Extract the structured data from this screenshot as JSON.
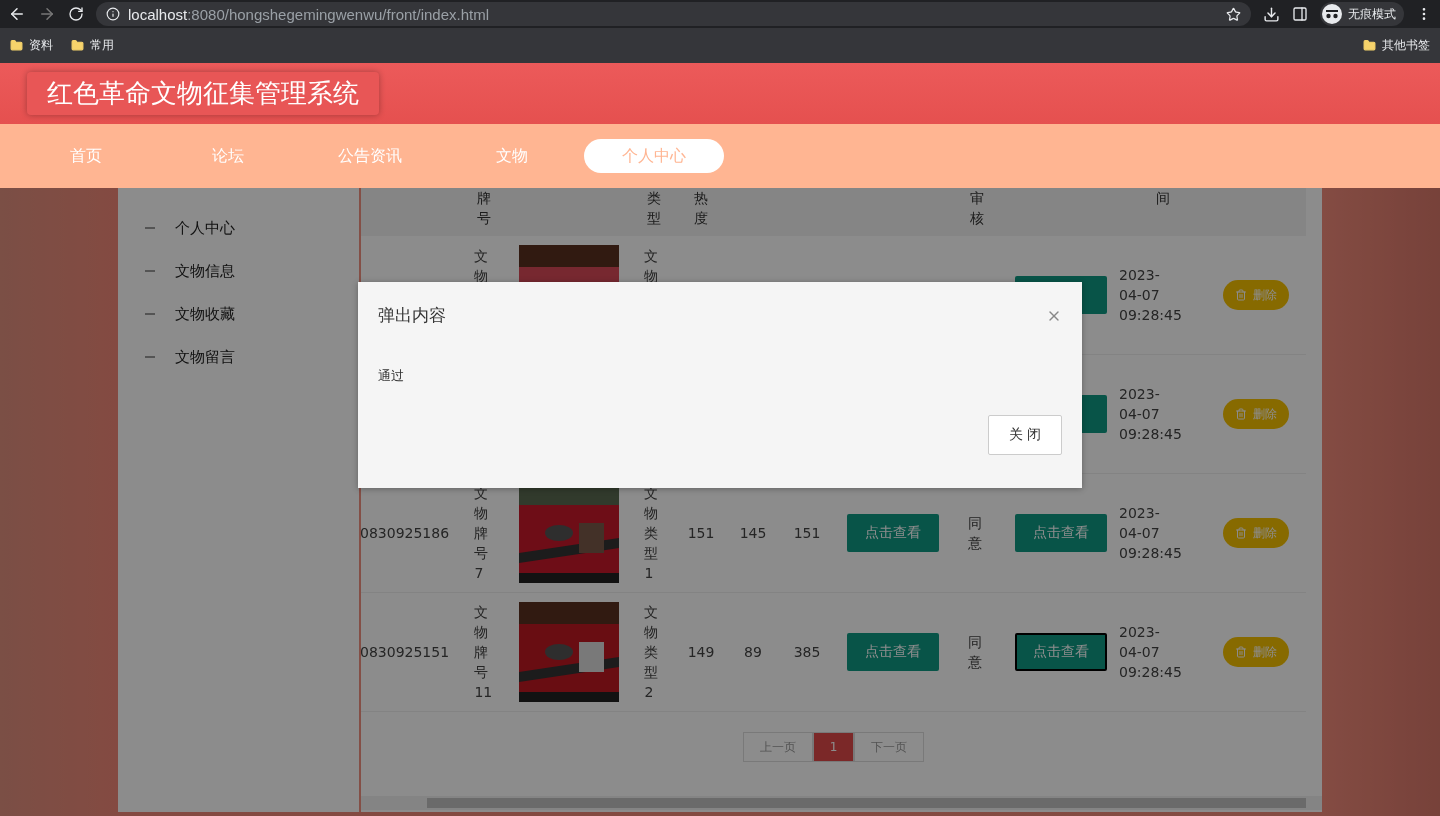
{
  "browser": {
    "url_host": "localhost",
    "url_rest": ":8080/hongshegemingwenwu/front/index.html",
    "profile": "无痕模式",
    "bookmarks": [
      "资料",
      "常用"
    ],
    "other_bookmarks": "其他书签"
  },
  "site": {
    "title": "红色革命文物征集管理系统"
  },
  "nav": [
    {
      "label": "首页",
      "selected": false
    },
    {
      "label": "论坛",
      "selected": false
    },
    {
      "label": "公告资讯",
      "selected": false
    },
    {
      "label": "文物",
      "selected": false
    },
    {
      "label": "个人中心",
      "selected": true
    }
  ],
  "sidebar": {
    "items": [
      "个人中心",
      "文物信息",
      "文物收藏",
      "文物留言"
    ]
  },
  "table": {
    "columns": [
      "",
      "牌号",
      "",
      "类型",
      "热度",
      "",
      "",
      "",
      "审核",
      "",
      "间",
      ""
    ],
    "rows": [
      {
        "card": "文物",
        "picture": true,
        "type": "文物",
        "time": "2023-\n04-07\n09:28:45",
        "delete": "删除",
        "review_focused": false
      },
      {
        "time": "2023-\n04-07\n09:28:45",
        "delete": "删除",
        "review_focused": false
      },
      {
        "number": "0830925186",
        "card": "文物牌号7",
        "picture": true,
        "type": "文物类型1",
        "hot": "151",
        "col6": "145",
        "col7": "151",
        "intro": "点击查看",
        "audit": "同意",
        "review": "点击查看",
        "time": "2023-\n04-07\n09:28:45",
        "delete": "删除",
        "review_focused": false
      },
      {
        "number": "0830925151",
        "card": "文物牌号11",
        "picture": true,
        "type": "文物类型2",
        "hot": "149",
        "col6": "89",
        "col7": "385",
        "intro": "点击查看",
        "audit": "同意",
        "review": "点击查看",
        "time": "2023-\n04-07\n09:28:45",
        "delete": "删除",
        "review_focused": true
      }
    ]
  },
  "pagination": {
    "prev": "上一页",
    "pages": [
      {
        "label": "1",
        "selected": true
      }
    ],
    "next": "下一页"
  },
  "modal": {
    "title": "弹出内容",
    "content": "通过",
    "close_button": "关 闭"
  }
}
